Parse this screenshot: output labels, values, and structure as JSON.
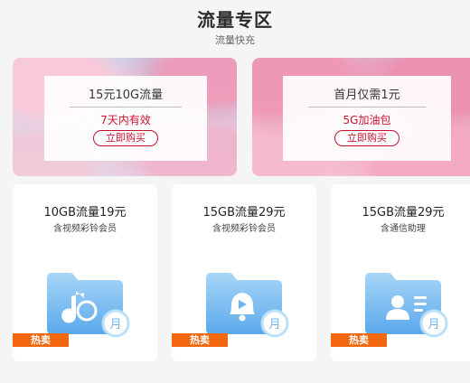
{
  "header": {
    "title": "流量专区",
    "subtitle": "流量快充"
  },
  "banners": [
    {
      "title": "15元10G流量",
      "tag": "7天内有效",
      "button": "立即购买"
    },
    {
      "title": "首月仅需1元",
      "tag": "5G加油包",
      "button": "立即购买"
    }
  ],
  "packages": [
    {
      "title": "10GB流量19元",
      "subtitle": "含视频彩铃会员",
      "badge": "热卖",
      "icon": "music-note-icon",
      "period": "月"
    },
    {
      "title": "15GB流量29元",
      "subtitle": "含视频彩铃会员",
      "badge": "热卖",
      "icon": "bell-play-icon",
      "period": "月"
    },
    {
      "title": "15GB流量29元",
      "subtitle": "含通信助理",
      "badge": "热卖",
      "icon": "contact-card-icon",
      "period": "月"
    }
  ],
  "colors": {
    "accent": "#c8102e",
    "hot_badge": "#f2660e",
    "icon_blue": "#6fb6f0"
  }
}
